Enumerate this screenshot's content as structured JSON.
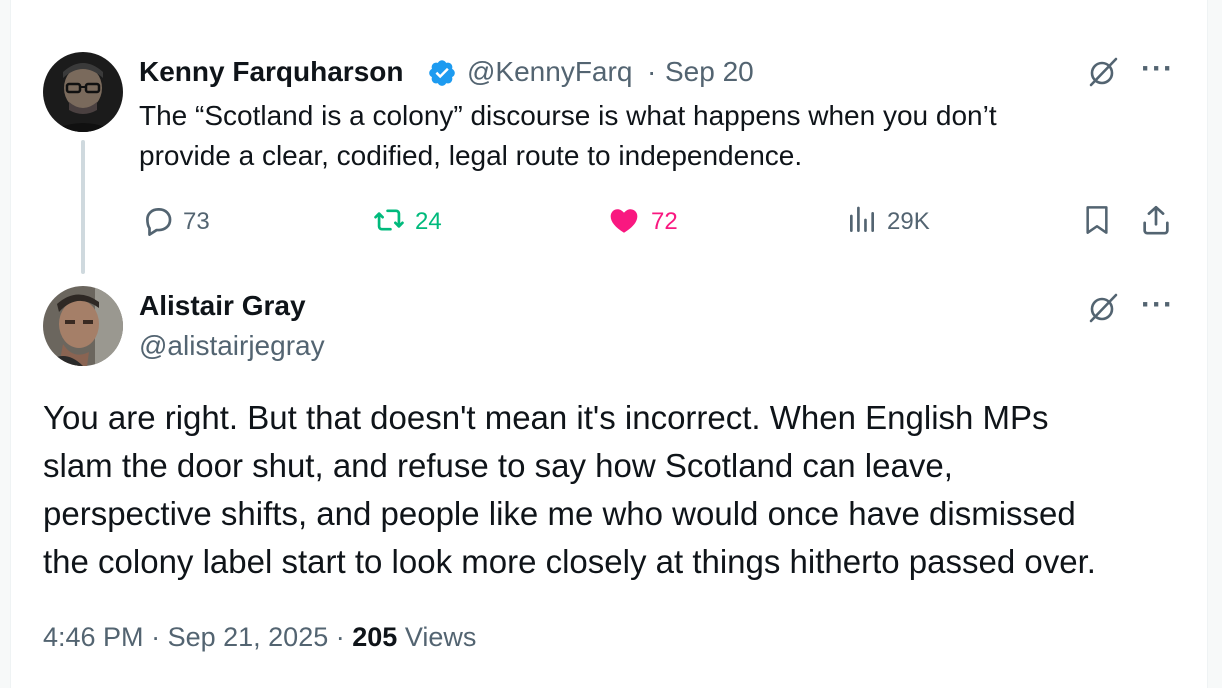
{
  "parent": {
    "author_name": "Kenny Farquharson",
    "handle": "@KennyFarq",
    "separator": "·",
    "date": "Sep 20",
    "text_line1": "The “Scotland is a colony” discourse is what happens when you don’t",
    "text_line2": "provide a clear, codified, legal route to independence.",
    "replies": "73",
    "reposts": "24",
    "likes": "72",
    "views": "29K",
    "verified": true
  },
  "reply": {
    "author_name": "Alistair Gray",
    "handle": "@alistairjegray",
    "text_lines": [
      "You are right. But that doesn't mean it's incorrect. When English MPs",
      "slam the door shut, and refuse to say how Scotland can leave,",
      "perspective shifts, and people like me who would once have dismissed",
      "the colony label start to look more closely at things hitherto passed over."
    ],
    "time": "4:46 PM",
    "date": "Sep 21, 2025",
    "views_count": "205",
    "views_label": "Views"
  },
  "icons": {
    "grok": "grok-icon",
    "more": "more-icon",
    "reply": "reply-icon",
    "repost": "repost-icon",
    "like": "heart-icon",
    "views": "views-icon",
    "bookmark": "bookmark-icon",
    "share": "share-icon"
  },
  "colors": {
    "text": "#0f1419",
    "secondary": "#536471",
    "verified": "#1d9bf0",
    "repost": "#00ba7c",
    "like": "#f91880"
  }
}
